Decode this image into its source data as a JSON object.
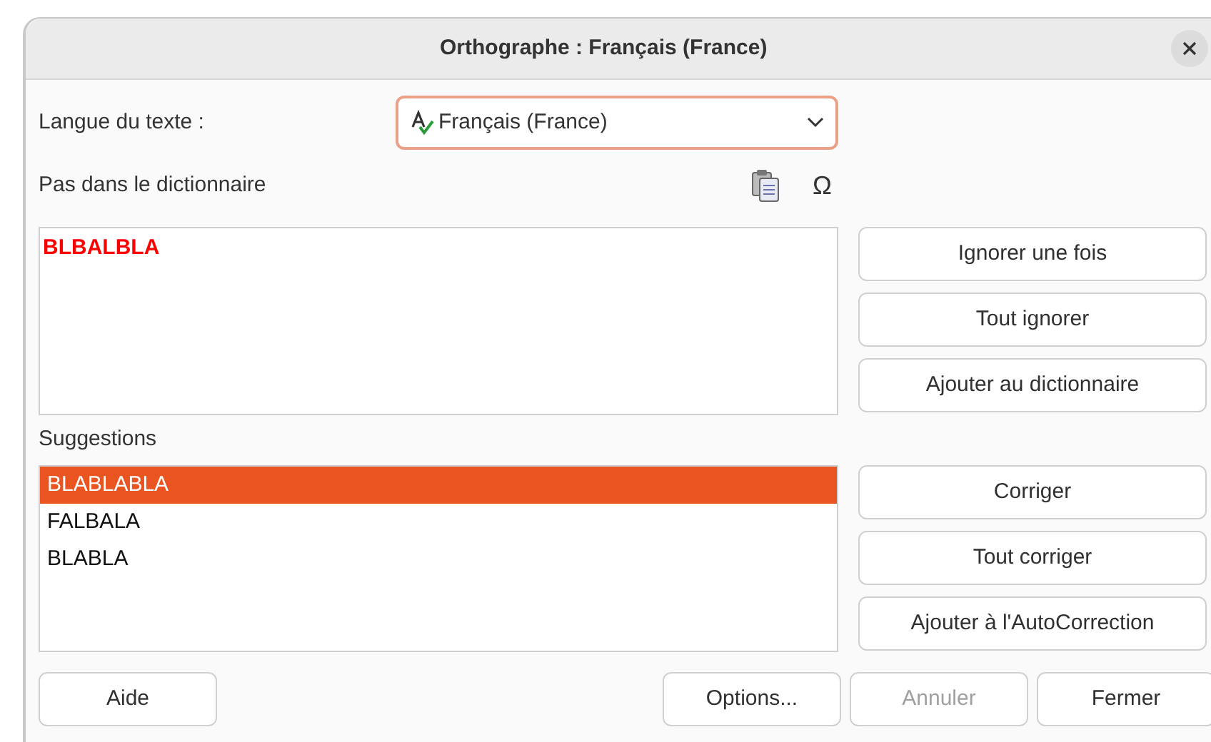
{
  "window": {
    "title": "Orthographe : Français (France)"
  },
  "language": {
    "label": "Langue du texte :",
    "value": "Français (France)"
  },
  "not_in_dictionary": {
    "label": "Pas dans le dictionnaire",
    "special_character_glyph": "Ω",
    "text": "BLBALBLA"
  },
  "side_buttons_top": [
    {
      "label": "Ignorer une fois",
      "disabled": false
    },
    {
      "label": "Tout ignorer",
      "disabled": false
    },
    {
      "label": "Ajouter au dictionnaire",
      "disabled": false
    }
  ],
  "suggestions": {
    "label": "Suggestions",
    "items": [
      {
        "text": "BLABLABLA",
        "selected": true
      },
      {
        "text": "FALBALA",
        "selected": false
      },
      {
        "text": "BLABLA",
        "selected": false
      }
    ]
  },
  "side_buttons_bottom": [
    {
      "label": "Corriger",
      "disabled": false
    },
    {
      "label": "Tout corriger",
      "disabled": false
    },
    {
      "label": "Ajouter à l'AutoCorrection",
      "disabled": false
    }
  ],
  "help_button": {
    "label": "Aide",
    "disabled": false
  },
  "footer_buttons": [
    {
      "label": "Options...",
      "disabled": false
    },
    {
      "label": "Annuler",
      "disabled": true
    },
    {
      "label": "Fermer",
      "disabled": false
    }
  ]
}
